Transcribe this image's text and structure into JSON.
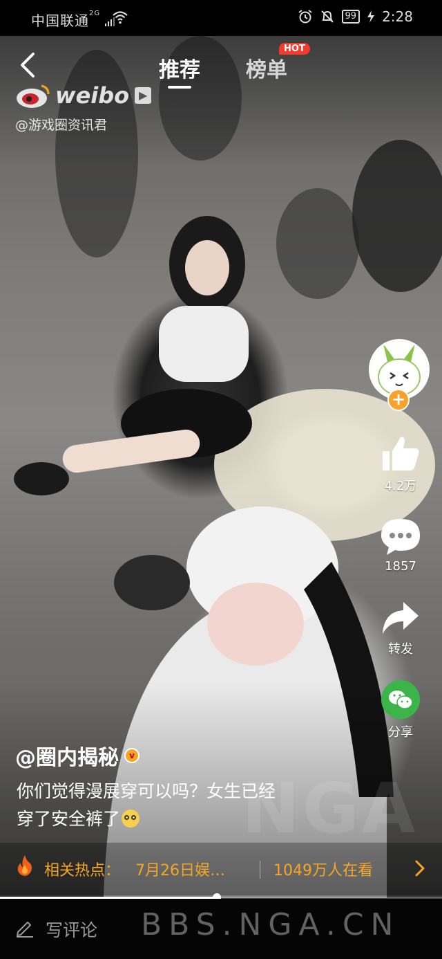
{
  "status_bar": {
    "carrier": "中国联通",
    "network": "2G",
    "battery": "99",
    "time": "2:28"
  },
  "header": {
    "tabs": [
      {
        "label": "推荐",
        "active": true
      },
      {
        "label": "榜单",
        "active": false,
        "badge": "HOT"
      }
    ],
    "logo_text": "weibo",
    "watermark_user": "@游戏圈资讯君"
  },
  "sidebar": {
    "likes": "4.2万",
    "comments": "1857",
    "repost_label": "转发",
    "share_label": "分享",
    "follow_symbol": "+"
  },
  "post": {
    "author": "@圈内揭秘",
    "verified_symbol": "v",
    "caption_line1": "你们觉得漫展穿可以吗？女生已经",
    "caption_line2": "穿了安全裤了"
  },
  "hot_topic": {
    "label": "相关热点：",
    "text": "7月26日娱…",
    "viewers": "1049万人在看"
  },
  "progress": {
    "fraction": 0.49
  },
  "bottom": {
    "comment_placeholder": "写评论",
    "site_watermark": "BBS.NGA.CN",
    "overlay_watermark": "NGA"
  },
  "colors": {
    "accent_orange": "#f6a623",
    "hot_badge": "#f33c2e",
    "wechat_green": "#3bb54a",
    "avatar_green": "#8bc34a"
  },
  "icons": [
    "back-icon",
    "wifi-icon",
    "alarm-icon",
    "mute-icon",
    "thumbs-up-icon",
    "comment-icon",
    "repost-icon",
    "wechat-icon",
    "flame-icon",
    "chevron-right-icon",
    "pen-icon"
  ]
}
